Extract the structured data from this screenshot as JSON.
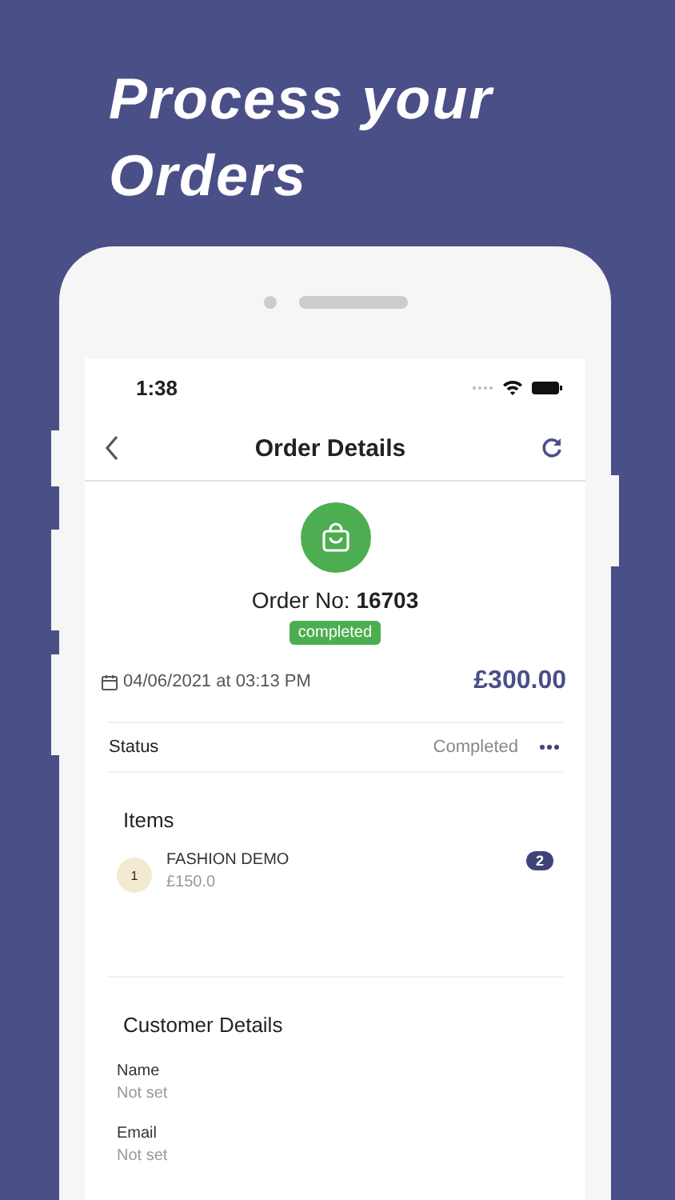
{
  "headline": "Process your Orders",
  "status_bar": {
    "time": "1:38"
  },
  "nav": {
    "title": "Order Details"
  },
  "order": {
    "number_label": "Order No:",
    "number": "16703",
    "status_badge": "completed",
    "date": "04/06/2021 at 03:13 PM",
    "total": "£300.00"
  },
  "status_row": {
    "label": "Status",
    "value": "Completed"
  },
  "items": {
    "title": "Items",
    "list": [
      {
        "index": "1",
        "name": "FASHION DEMO",
        "price": "£150.0",
        "quantity": "2"
      }
    ]
  },
  "customer": {
    "title": "Customer Details",
    "fields": [
      {
        "label": "Name",
        "value": "Not set"
      },
      {
        "label": "Email",
        "value": "Not set"
      }
    ]
  }
}
